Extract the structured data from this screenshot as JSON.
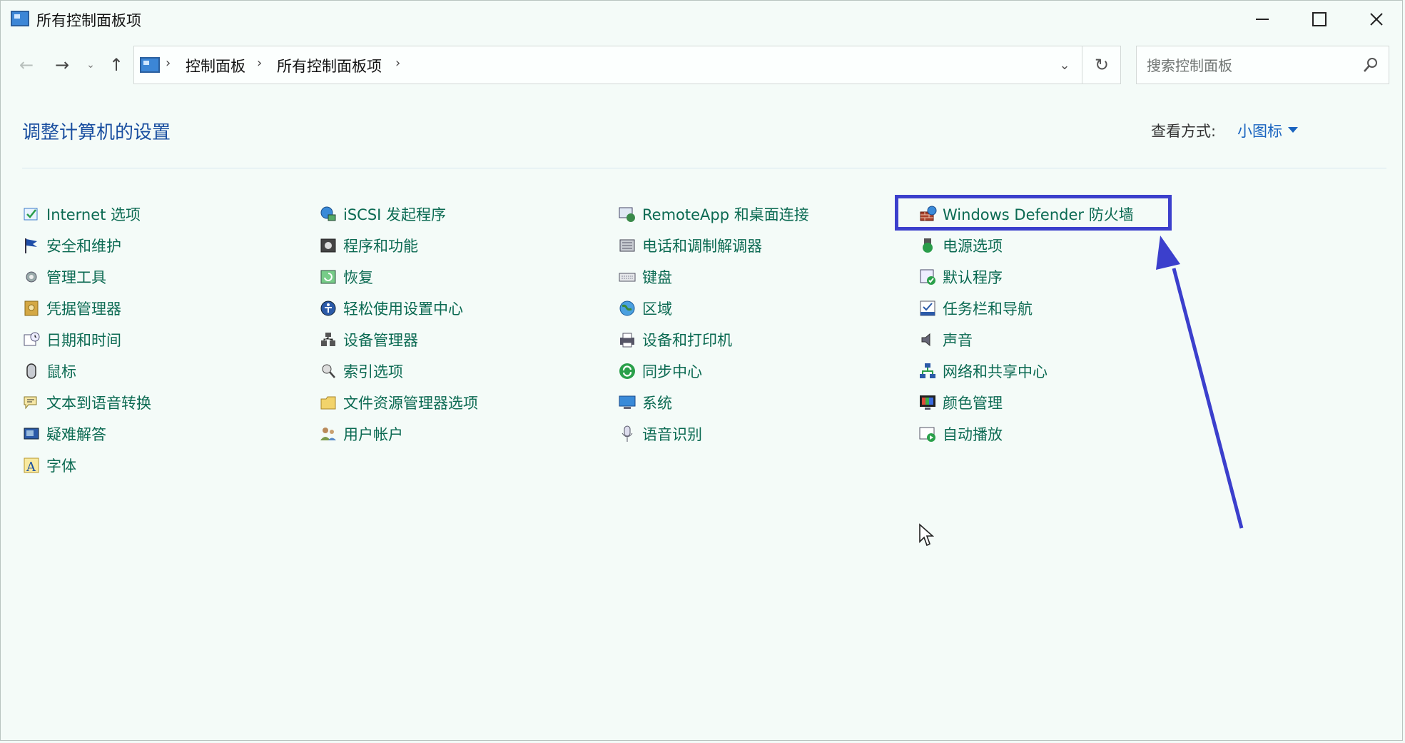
{
  "window": {
    "title": "所有控制面板项",
    "minimize_symbol": "—",
    "close_symbol": "✕"
  },
  "nav": {
    "back_symbol": "←",
    "forward_symbol": "→",
    "recent_symbol": "⌄",
    "up_symbol": "↑"
  },
  "address": {
    "crumbs": [
      "控制面板",
      "所有控制面板项"
    ],
    "separator": "›",
    "dropdown_symbol": "⌄",
    "refresh_symbol": "↻"
  },
  "search": {
    "placeholder": "搜索控制面板"
  },
  "header": {
    "title": "调整计算机的设置",
    "view_label": "查看方式:",
    "view_value": "小图标"
  },
  "items": {
    "col1": [
      {
        "label": "Internet 选项",
        "icon": "internet-options-icon"
      },
      {
        "label": "安全和维护",
        "icon": "flag-icon"
      },
      {
        "label": "管理工具",
        "icon": "admin-tools-icon"
      },
      {
        "label": "凭据管理器",
        "icon": "credential-manager-icon"
      },
      {
        "label": "日期和时间",
        "icon": "calendar-clock-icon"
      },
      {
        "label": "鼠标",
        "icon": "mouse-icon"
      },
      {
        "label": "文本到语音转换",
        "icon": "speech-text-icon"
      },
      {
        "label": "疑难解答",
        "icon": "troubleshoot-icon"
      },
      {
        "label": "字体",
        "icon": "font-icon"
      }
    ],
    "col2": [
      {
        "label": "iSCSI 发起程序",
        "icon": "iscsi-icon"
      },
      {
        "label": "程序和功能",
        "icon": "programs-icon"
      },
      {
        "label": "恢复",
        "icon": "recovery-icon"
      },
      {
        "label": "轻松使用设置中心",
        "icon": "ease-of-access-icon"
      },
      {
        "label": "设备管理器",
        "icon": "device-manager-icon"
      },
      {
        "label": "索引选项",
        "icon": "indexing-icon"
      },
      {
        "label": "文件资源管理器选项",
        "icon": "folder-options-icon"
      },
      {
        "label": "用户帐户",
        "icon": "user-accounts-icon"
      }
    ],
    "col3": [
      {
        "label": "RemoteApp 和桌面连接",
        "icon": "remoteapp-icon"
      },
      {
        "label": "电话和调制解调器",
        "icon": "phone-modem-icon"
      },
      {
        "label": "键盘",
        "icon": "keyboard-icon"
      },
      {
        "label": "区域",
        "icon": "globe-icon"
      },
      {
        "label": "设备和打印机",
        "icon": "printer-icon"
      },
      {
        "label": "同步中心",
        "icon": "sync-icon"
      },
      {
        "label": "系统",
        "icon": "system-icon"
      },
      {
        "label": "语音识别",
        "icon": "microphone-icon"
      }
    ],
    "col4": [
      {
        "label": "Windows Defender 防火墙",
        "icon": "firewall-icon"
      },
      {
        "label": "电源选项",
        "icon": "power-icon"
      },
      {
        "label": "默认程序",
        "icon": "default-programs-icon"
      },
      {
        "label": "任务栏和导航",
        "icon": "taskbar-icon"
      },
      {
        "label": "声音",
        "icon": "speaker-icon"
      },
      {
        "label": "网络和共享中心",
        "icon": "network-icon"
      },
      {
        "label": "颜色管理",
        "icon": "color-management-icon"
      },
      {
        "label": "自动播放",
        "icon": "autoplay-icon"
      }
    ]
  },
  "colors": {
    "link": "#0b6a52",
    "title": "#1a4fa0",
    "highlight": "#3b3fcc"
  }
}
